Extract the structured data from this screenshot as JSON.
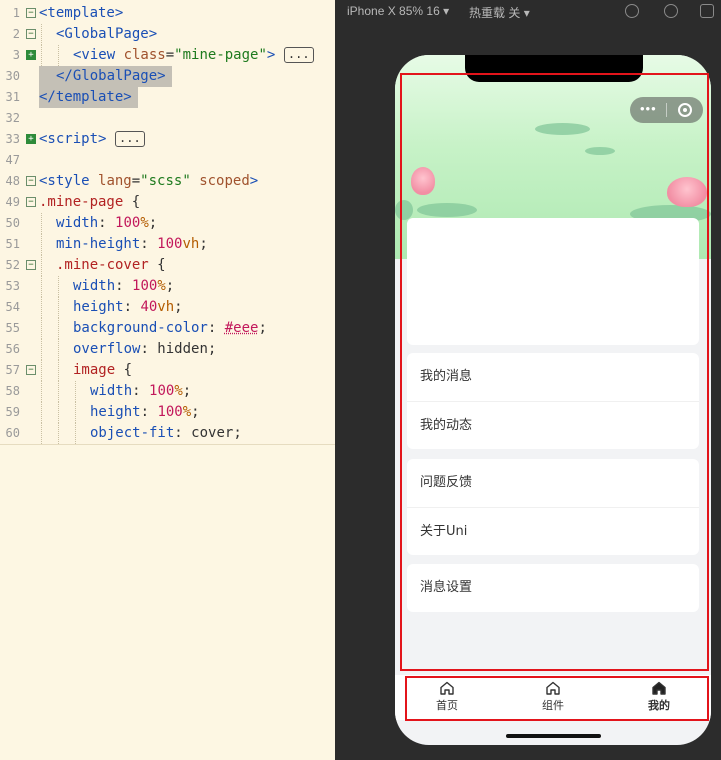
{
  "editor": {
    "lines": [
      {
        "n": "1",
        "fold": "minus",
        "indent": 0,
        "segments": [
          {
            "t": "<template>",
            "c": "tag"
          }
        ]
      },
      {
        "n": "2",
        "fold": "minus",
        "indent": 1,
        "segments": [
          {
            "t": "<GlobalPage>",
            "c": "tag"
          }
        ]
      },
      {
        "n": "3",
        "fold": "plus",
        "indent": 2,
        "segments": [
          {
            "t": "<view ",
            "c": "tag"
          },
          {
            "t": "class",
            "c": "attr"
          },
          {
            "t": "=",
            "c": ""
          },
          {
            "t": "\"mine-page\"",
            "c": "str"
          },
          {
            "t": ">",
            "c": "tag"
          }
        ],
        "ellipsis": "..."
      },
      {
        "n": "30",
        "fold": "",
        "indent": 1,
        "segments": [
          {
            "t": "</GlobalPage>",
            "c": "tag"
          }
        ],
        "highlight": true
      },
      {
        "n": "31",
        "fold": "",
        "indent": 0,
        "segments": [
          {
            "t": "</template>",
            "c": "tag"
          }
        ],
        "highlight": true
      },
      {
        "n": "32",
        "fold": "",
        "indent": 0,
        "segments": []
      },
      {
        "n": "33",
        "fold": "plus",
        "indent": 0,
        "segments": [
          {
            "t": "<script>",
            "c": "tag"
          }
        ],
        "ellipsis": "..."
      },
      {
        "n": "47",
        "fold": "",
        "indent": 0,
        "segments": []
      },
      {
        "n": "48",
        "fold": "minus",
        "indent": 0,
        "segments": [
          {
            "t": "<style ",
            "c": "tag"
          },
          {
            "t": "lang",
            "c": "attr"
          },
          {
            "t": "=",
            "c": ""
          },
          {
            "t": "\"scss\"",
            "c": "str"
          },
          {
            "t": " ",
            "c": ""
          },
          {
            "t": "scoped",
            "c": "attr"
          },
          {
            "t": ">",
            "c": "tag"
          }
        ]
      },
      {
        "n": "49",
        "fold": "minus",
        "indent": 0,
        "segments": [
          {
            "t": ".mine-page",
            "c": "sel"
          },
          {
            "t": " {",
            "c": ""
          }
        ]
      },
      {
        "n": "50",
        "fold": "",
        "indent": 1,
        "segments": [
          {
            "t": "width",
            "c": "prop"
          },
          {
            "t": ": ",
            "c": ""
          },
          {
            "t": "100",
            "c": "num"
          },
          {
            "t": "%",
            "c": "unit"
          },
          {
            "t": ";",
            "c": ""
          }
        ]
      },
      {
        "n": "51",
        "fold": "",
        "indent": 1,
        "segments": [
          {
            "t": "min-height",
            "c": "prop"
          },
          {
            "t": ": ",
            "c": ""
          },
          {
            "t": "100",
            "c": "num"
          },
          {
            "t": "vh",
            "c": "unit"
          },
          {
            "t": ";",
            "c": ""
          }
        ]
      },
      {
        "n": "52",
        "fold": "minus",
        "indent": 1,
        "segments": [
          {
            "t": ".mine-cover",
            "c": "sel"
          },
          {
            "t": " {",
            "c": ""
          }
        ]
      },
      {
        "n": "53",
        "fold": "",
        "indent": 2,
        "segments": [
          {
            "t": "width",
            "c": "prop"
          },
          {
            "t": ": ",
            "c": ""
          },
          {
            "t": "100",
            "c": "num"
          },
          {
            "t": "%",
            "c": "unit"
          },
          {
            "t": ";",
            "c": ""
          }
        ]
      },
      {
        "n": "54",
        "fold": "",
        "indent": 2,
        "segments": [
          {
            "t": "height",
            "c": "prop"
          },
          {
            "t": ": ",
            "c": ""
          },
          {
            "t": "40",
            "c": "num"
          },
          {
            "t": "vh",
            "c": "unit"
          },
          {
            "t": ";",
            "c": ""
          }
        ]
      },
      {
        "n": "55",
        "fold": "",
        "indent": 2,
        "segments": [
          {
            "t": "background-color",
            "c": "prop"
          },
          {
            "t": ": ",
            "c": ""
          },
          {
            "t": "#eee",
            "c": "col"
          },
          {
            "t": ";",
            "c": ""
          }
        ]
      },
      {
        "n": "56",
        "fold": "",
        "indent": 2,
        "segments": [
          {
            "t": "overflow",
            "c": "prop"
          },
          {
            "t": ": ",
            "c": ""
          },
          {
            "t": "hidden",
            "c": ""
          },
          {
            "t": ";",
            "c": ""
          }
        ]
      },
      {
        "n": "57",
        "fold": "minus",
        "indent": 2,
        "segments": [
          {
            "t": "image",
            "c": "sel"
          },
          {
            "t": " {",
            "c": ""
          }
        ]
      },
      {
        "n": "58",
        "fold": "",
        "indent": 3,
        "segments": [
          {
            "t": "width",
            "c": "prop"
          },
          {
            "t": ": ",
            "c": ""
          },
          {
            "t": "100",
            "c": "num"
          },
          {
            "t": "%",
            "c": "unit"
          },
          {
            "t": ";",
            "c": ""
          }
        ]
      },
      {
        "n": "59",
        "fold": "",
        "indent": 3,
        "segments": [
          {
            "t": "height",
            "c": "prop"
          },
          {
            "t": ": ",
            "c": ""
          },
          {
            "t": "100",
            "c": "num"
          },
          {
            "t": "%",
            "c": "unit"
          },
          {
            "t": ";",
            "c": ""
          }
        ]
      },
      {
        "n": "60",
        "fold": "",
        "indent": 3,
        "segments": [
          {
            "t": "object-fit",
            "c": "prop"
          },
          {
            "t": ": ",
            "c": ""
          },
          {
            "t": "cover",
            "c": ""
          },
          {
            "t": ";",
            "c": ""
          }
        ]
      }
    ]
  },
  "simulator": {
    "device_label": "iPhone X 85% 16",
    "device_caret": "▾",
    "reload_label": "热重载 关",
    "reload_caret": "▾"
  },
  "page": {
    "capsule_dots": "•••",
    "menu_groups": [
      [
        "我的消息",
        "我的动态"
      ],
      [
        "问题反馈",
        "关于Uni"
      ],
      [
        "消息设置"
      ]
    ],
    "tabs": [
      {
        "label": "首页",
        "icon": "home-outline-icon",
        "active": false
      },
      {
        "label": "组件",
        "icon": "home-outline-icon",
        "active": false
      },
      {
        "label": "我的",
        "icon": "home-filled-icon",
        "active": true
      }
    ]
  },
  "colors": {
    "highlight_box": "#e3141b",
    "page_background": "#f2f3f5",
    "cover_green": "#c7f2c7"
  }
}
